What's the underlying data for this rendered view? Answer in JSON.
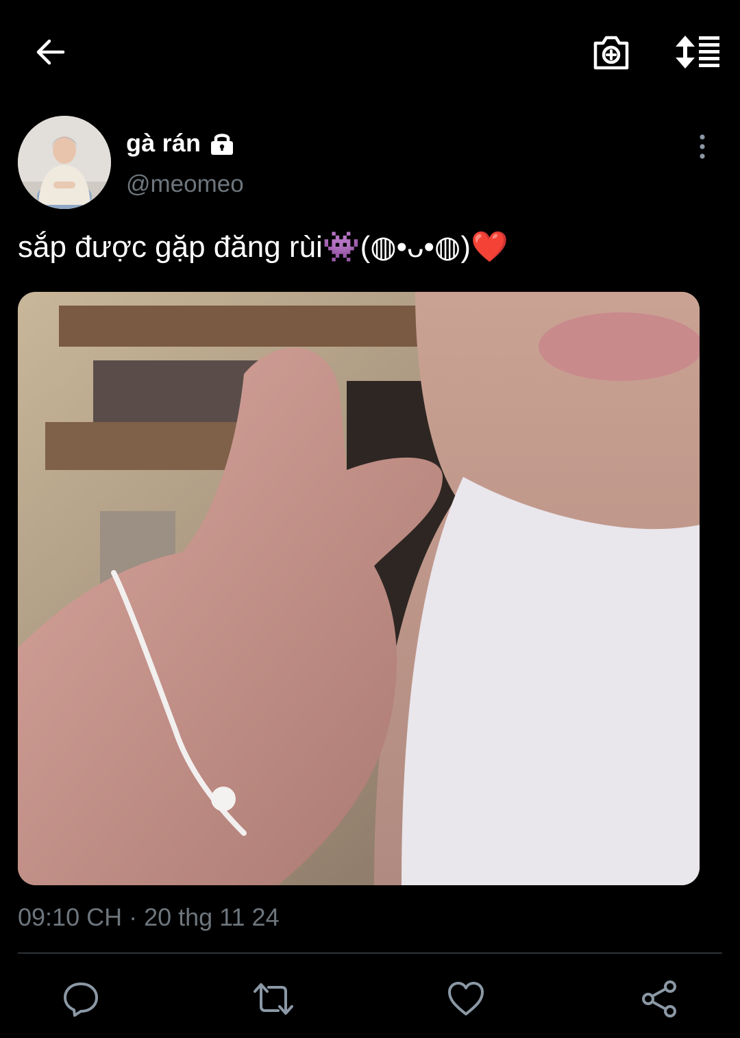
{
  "topbar": {
    "back_icon": "arrow-left-icon",
    "camera_icon": "camera-add-icon",
    "sort_icon": "sort-replies-icon"
  },
  "author": {
    "display_name": "gà rán",
    "handle": "@meomeo",
    "protected_icon": "lock-icon",
    "more_icon": "more-vertical-icon"
  },
  "tweet": {
    "text": "sắp được gặp đăng rùi👾(◍•ᴗ•◍)❤️",
    "timestamp": "09:10 CH · 20 thg 11 24"
  },
  "actions": {
    "reply_icon": "reply-icon",
    "retweet_icon": "retweet-icon",
    "like_icon": "heart-icon",
    "share_icon": "share-icon"
  },
  "colors": {
    "background": "#000000",
    "primary_text": "#ffffff",
    "secondary_text": "#6e767d",
    "divider": "#2f3336",
    "icon": "#8b98a5"
  }
}
